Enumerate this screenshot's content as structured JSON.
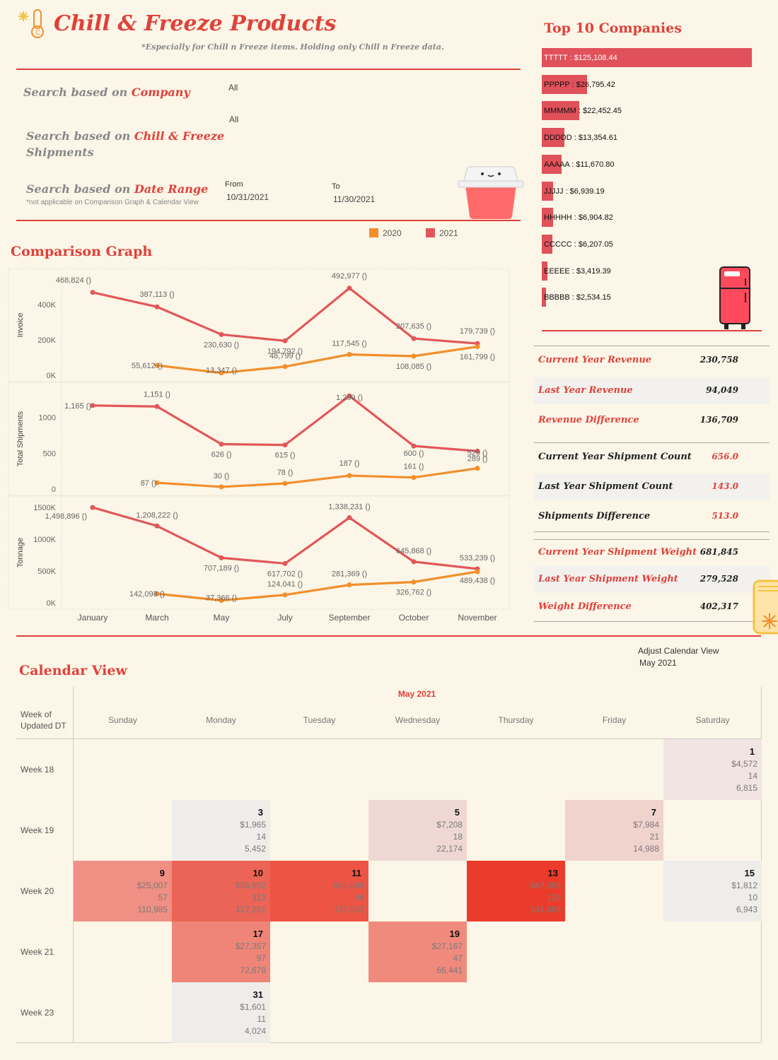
{
  "header": {
    "title": "Chill & Freeze Products",
    "subtitle": "*Especially for Chill n Freeze items. Holding only Chill n Freeze data."
  },
  "filters": {
    "company": {
      "label_pre": "Search based on ",
      "label_acc": "Company",
      "value": "All"
    },
    "shipments": {
      "label_pre": "Search based on ",
      "label_acc": "Chill & Freeze",
      "label_post": "Shipments",
      "value": "All"
    },
    "date": {
      "label_pre": "Search based on ",
      "label_acc": "Date Range",
      "note": "*not applicable on Comparison Graph & Calendar View",
      "from_label": "From",
      "from_value": "10/31/2021",
      "to_label": "To",
      "to_value": "11/30/2021"
    }
  },
  "legend": [
    {
      "label": "2020",
      "color": "#f28e2b"
    },
    {
      "label": "2021",
      "color": "#e15759"
    }
  ],
  "comparison_title": "Comparison Graph",
  "top10": {
    "title": "Top 10 Companies",
    "items": [
      {
        "label": "TTTTT : $125,108.44",
        "value": 125108.44
      },
      {
        "label": "PPPPP : $26,795.42",
        "value": 26795.42
      },
      {
        "label": "MMMMM : $22,452.45",
        "value": 22452.45
      },
      {
        "label": "DDDDD : $13,354.61",
        "value": 13354.61
      },
      {
        "label": "AAAAA : $11,670.80",
        "value": 11670.8
      },
      {
        "label": "JJJJJ : $6,939.19",
        "value": 6939.19
      },
      {
        "label": "HHHHH : $6,904.82",
        "value": 6904.82
      },
      {
        "label": "CCCCC : $6,207.05",
        "value": 6207.05
      },
      {
        "label": "EEEEE : $3,419.39",
        "value": 3419.39
      },
      {
        "label": "BBBBB : $2,534.15",
        "value": 2534.15
      }
    ]
  },
  "kpis": {
    "revenue": [
      {
        "label": "Current Year Revenue",
        "value": "230,758"
      },
      {
        "label": "Last Year Revenue",
        "value": "94,049"
      },
      {
        "label": "Revenue Difference",
        "value": "136,709"
      }
    ],
    "shipments": [
      {
        "label": "Current Year Shipment Count",
        "value": "656.0"
      },
      {
        "label": "Last Year Shipment Count",
        "value": "143.0"
      },
      {
        "label": "Shipments Difference",
        "value": "513.0"
      }
    ],
    "weight": [
      {
        "label": "Current Year Shipment Weight",
        "value": "681,845"
      },
      {
        "label": "Last Year Shipment Weight",
        "value": "279,528"
      },
      {
        "label": "Weight Difference",
        "value": "402,317"
      }
    ]
  },
  "chart_data": {
    "type": "line",
    "categories": [
      "January",
      "March",
      "May",
      "July",
      "September",
      "October",
      "November"
    ],
    "panels": [
      {
        "ylabel": "Invoice",
        "ylim": [
          0,
          500000
        ],
        "ticks": [
          {
            "v": 0,
            "l": "0K"
          },
          {
            "v": 200000,
            "l": "200K"
          },
          {
            "v": 400000,
            "l": "400K"
          }
        ],
        "series": [
          {
            "name": "2021",
            "color": "#e15759",
            "values": [
              468824,
              387113,
              230630,
              194792,
              492977,
              207635,
              179739
            ],
            "labels": [
              "468,824 ()",
              "387,113 ()",
              "230,630 ()",
              "194,792 ()",
              "492,977 ()",
              "207,635 ()",
              "179,739 ()"
            ]
          },
          {
            "name": "2020",
            "color": "#f28e2b",
            "values": [
              55612,
              13347,
              48799,
              117545,
              108085,
              161799
            ],
            "idx": [
              1,
              2,
              3,
              4,
              5,
              6
            ],
            "labels": [
              "55,612 ()",
              "13,347 ()",
              "48,799 ()",
              "117,545 ()",
              "108,085 ()",
              "161,799 ()"
            ]
          }
        ]
      },
      {
        "ylabel": "Total Shipments",
        "ylim": [
          0,
          1400
        ],
        "ticks": [
          {
            "v": 0,
            "l": "0"
          },
          {
            "v": 500,
            "l": "500"
          },
          {
            "v": 1000,
            "l": "1000"
          }
        ],
        "series": [
          {
            "name": "2021",
            "color": "#e15759",
            "values": [
              1165,
              1151,
              626,
              615,
              1299,
              600,
              529
            ],
            "labels": [
              "1,165 ()",
              "1,151 ()",
              "626 ()",
              "615 ()",
              "1,299 ()",
              "600 ()",
              "529 ()"
            ]
          },
          {
            "name": "2020",
            "color": "#f28e2b",
            "values": [
              87,
              30,
              78,
              187,
              161,
              289
            ],
            "idx": [
              1,
              2,
              3,
              4,
              5,
              6
            ],
            "labels": [
              "87 ()",
              "30 ()",
              "78 ()",
              "187 ()",
              "161 ()",
              "289 ()"
            ]
          }
        ]
      },
      {
        "ylabel": "Tonnage",
        "ylim": [
          0,
          1600000
        ],
        "ticks": [
          {
            "v": 0,
            "l": "0K"
          },
          {
            "v": 500000,
            "l": "500K"
          },
          {
            "v": 1000000,
            "l": "1000K"
          },
          {
            "v": 1500000,
            "l": "1500K"
          }
        ],
        "series": [
          {
            "name": "2021",
            "color": "#e15759",
            "values": [
              1498896,
              1208222,
              707189,
              617702,
              1338231,
              645868,
              533239
            ],
            "labels": [
              "1,498,896 ()",
              "1,208,222 ()",
              "707,189 ()",
              "617,702 ()",
              "1,338,231 ()",
              "645,868 ()",
              "533,239 ()"
            ]
          },
          {
            "name": "2020",
            "color": "#f28e2b",
            "values": [
              142098,
              37366,
              124041,
              281369,
              326762,
              489438
            ],
            "idx": [
              1,
              2,
              3,
              4,
              5,
              6
            ],
            "labels": [
              "142,098 ()",
              "37,366 ()",
              "124,041 ()",
              "281,369 ()",
              "326,762 ()",
              "489,438 ()"
            ]
          }
        ]
      }
    ]
  },
  "calendar": {
    "title": "Calendar View",
    "adjust_label": "Adjust Calendar View",
    "adjust_value": "May 2021",
    "month": "May 2021",
    "row_header": "Week of Updated DT",
    "days": [
      "Sunday",
      "Monday",
      "Tuesday",
      "Wednesday",
      "Thursday",
      "Friday",
      "Saturday"
    ],
    "weeks": [
      "Week 18",
      "Week 19",
      "Week 20",
      "Week 21",
      "Week 23"
    ],
    "cells": [
      {
        "week": 0,
        "dow": 6,
        "day": "1",
        "revenue": "$4,572",
        "count": "14",
        "weight": "6,815",
        "color": "#f2e4e2"
      },
      {
        "week": 1,
        "dow": 1,
        "day": "3",
        "revenue": "$1,965",
        "count": "14",
        "weight": "5,452",
        "color": "#efedea"
      },
      {
        "week": 1,
        "dow": 3,
        "day": "5",
        "revenue": "$7,208",
        "count": "18",
        "weight": "22,174",
        "color": "#efd8d3"
      },
      {
        "week": 1,
        "dow": 5,
        "day": "7",
        "revenue": "$7,984",
        "count": "21",
        "weight": "14,988",
        "color": "#f0d3cd"
      },
      {
        "week": 2,
        "dow": 0,
        "day": "9",
        "revenue": "$25,007",
        "count": "57",
        "weight": "110,985",
        "color": "#f08f83"
      },
      {
        "week": 2,
        "dow": 1,
        "day": "10",
        "revenue": "$36,902",
        "count": "113",
        "weight": "117,281",
        "color": "#ec6455"
      },
      {
        "week": 2,
        "dow": 2,
        "day": "11",
        "revenue": "$41,698",
        "count": "96",
        "weight": "137,819",
        "color": "#ee5444"
      },
      {
        "week": 2,
        "dow": 4,
        "day": "13",
        "revenue": "$47,368",
        "count": "128",
        "weight": "141,889",
        "color": "#ec3b2a"
      },
      {
        "week": 2,
        "dow": 6,
        "day": "15",
        "revenue": "$1,812",
        "count": "10",
        "weight": "6,943",
        "color": "#efedea"
      },
      {
        "week": 3,
        "dow": 1,
        "day": "17",
        "revenue": "$27,357",
        "count": "97",
        "weight": "72,678",
        "color": "#ef8578"
      },
      {
        "week": 3,
        "dow": 3,
        "day": "19",
        "revenue": "$27,167",
        "count": "47",
        "weight": "66,441",
        "color": "#f08a7d"
      },
      {
        "week": 4,
        "dow": 1,
        "day": "31",
        "revenue": "$1,601",
        "count": "11",
        "weight": "4,024",
        "color": "#efedea"
      }
    ]
  }
}
